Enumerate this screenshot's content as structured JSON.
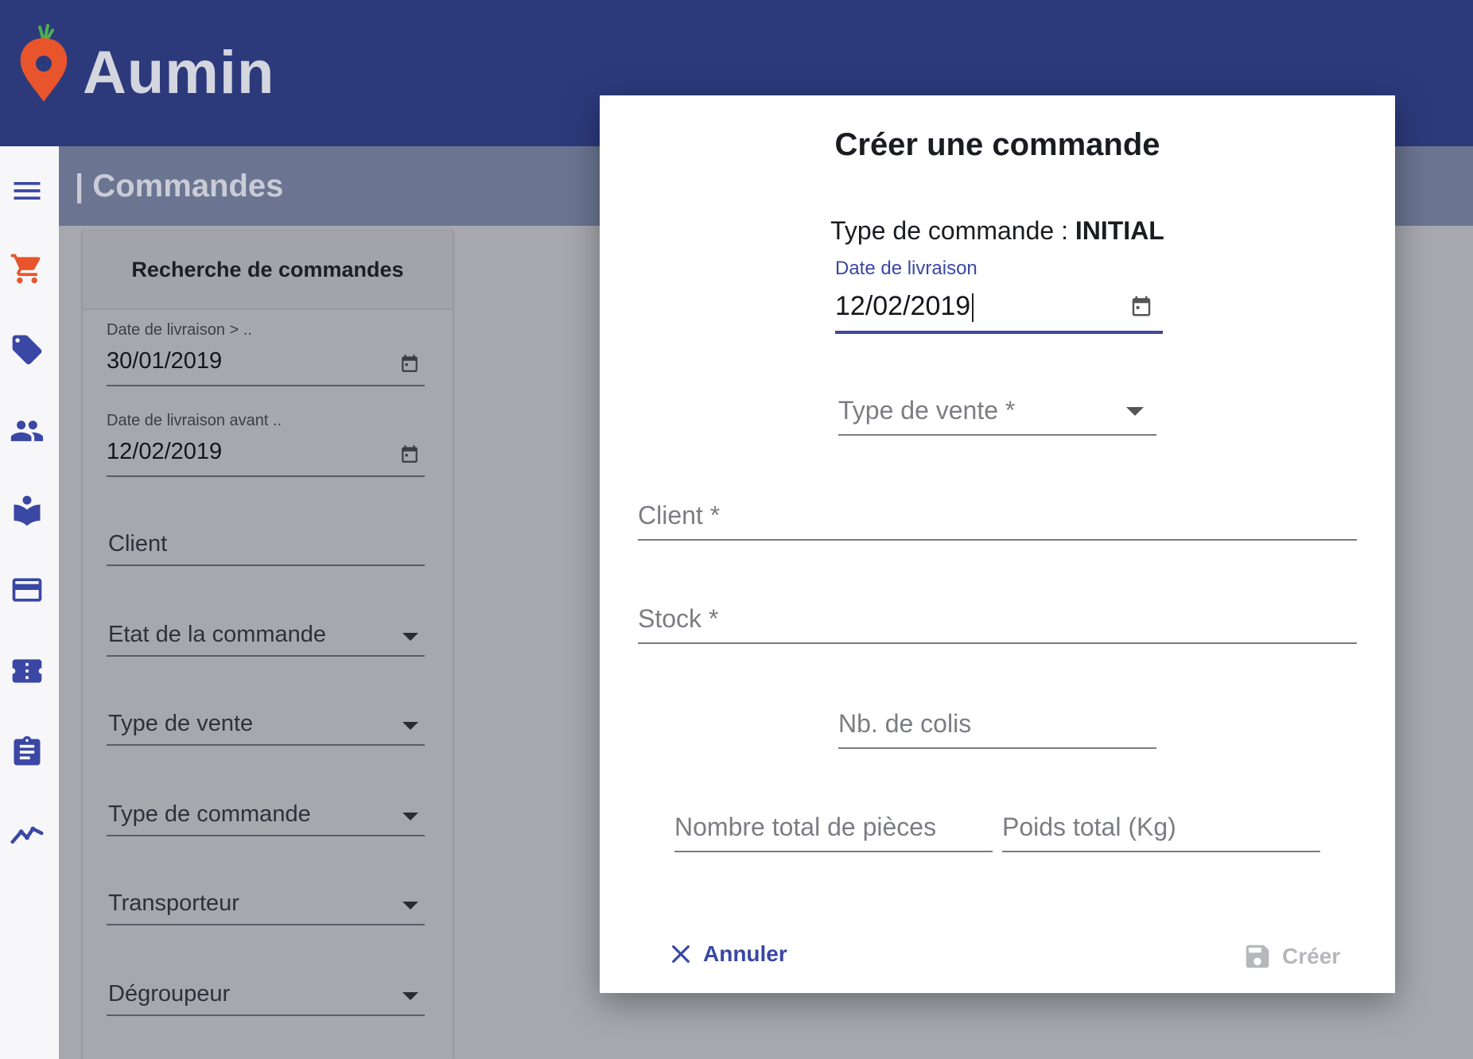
{
  "app": {
    "title": "Aumin"
  },
  "header": {
    "section_title": "| Commandes"
  },
  "sidebar": {
    "items": [
      {
        "icon": "menu-icon",
        "color": "#3a47a4"
      },
      {
        "icon": "cart-icon",
        "color": "#e8542c"
      },
      {
        "icon": "tag-icon",
        "color": "#3a47a4"
      },
      {
        "icon": "people-icon",
        "color": "#3a47a4"
      },
      {
        "icon": "reader-icon",
        "color": "#3a47a4"
      },
      {
        "icon": "card-icon",
        "color": "#3a47a4"
      },
      {
        "icon": "ticket-icon",
        "color": "#3a47a4"
      },
      {
        "icon": "clipboard-icon",
        "color": "#3a47a4"
      },
      {
        "icon": "trending-icon",
        "color": "#3a47a4"
      }
    ]
  },
  "search": {
    "title": "Recherche de commandes",
    "date_after_label": "Date de livraison > ..",
    "date_after_value": "30/01/2019",
    "date_before_label": "Date de livraison avant ..",
    "date_before_value": "12/02/2019",
    "client_placeholder": "Client",
    "etat_placeholder": "Etat de la commande",
    "type_vente_placeholder": "Type de vente",
    "type_commande_placeholder": "Type de commande",
    "transporteur_placeholder": "Transporteur",
    "degroupeur_placeholder": "Dégroupeur"
  },
  "modal": {
    "title": "Créer une commande",
    "type_label": "Type de commande : ",
    "type_value": "INITIAL",
    "date_label": "Date de livraison",
    "date_value": "12/02/2019",
    "type_vente_placeholder": "Type de vente",
    "client_placeholder": "Client",
    "stock_placeholder": "Stock",
    "required_mark": " *",
    "colis_placeholder": "Nb. de colis",
    "pieces_placeholder": "Nombre total de pièces",
    "poids_placeholder": "Poids total (Kg)",
    "cancel_label": "Annuler",
    "create_label": "Créer"
  },
  "colors": {
    "primary": "#3a47a4",
    "topbar": "#2c3a7c",
    "accent": "#e8542c",
    "disabled": "#b6b7bb"
  }
}
